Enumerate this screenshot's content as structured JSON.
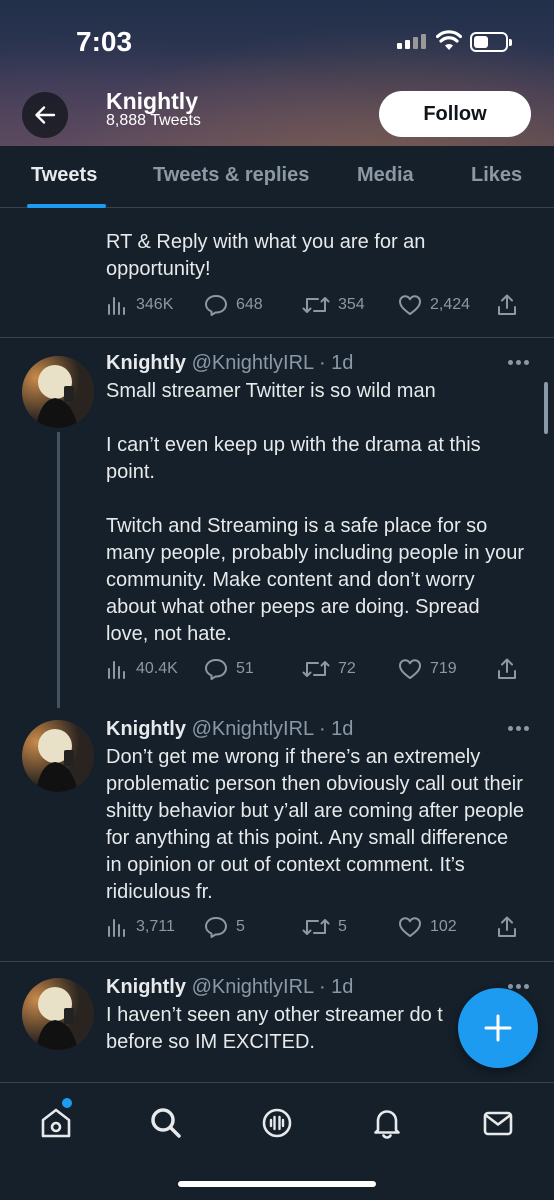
{
  "status_bar": {
    "time": "7:03"
  },
  "header": {
    "name": "Knightly",
    "tweet_count": "8,888 Tweets",
    "follow_label": "Follow"
  },
  "tabs": [
    {
      "label": "Tweets",
      "active": true
    },
    {
      "label": "Tweets & replies",
      "active": false
    },
    {
      "label": "Media",
      "active": false
    },
    {
      "label": "Likes",
      "active": false
    }
  ],
  "tweets": [
    {
      "text": "RT & Reply with what you are for an\nopportunity!",
      "views": "346K",
      "replies": "648",
      "retweets": "354",
      "likes": "2,424"
    },
    {
      "name": "Knightly",
      "handle": "@KnightlyIRL",
      "time": "· 1d",
      "text": "Small streamer Twitter is so wild man\n\nI can’t even keep up with the drama at this point.\n\nTwitch and Streaming is a safe place for so many people, probably including people in your community. Make content and don’t worry about what other peeps are doing. Spread love, not hate.",
      "views": "40.4K",
      "replies": "51",
      "retweets": "72",
      "likes": "719"
    },
    {
      "name": "Knightly",
      "handle": "@KnightlyIRL",
      "time": "· 1d",
      "text": "Don’t get me wrong if there’s an extremely problematic person then obviously call out their shitty behavior but y’all are coming after people for anything at this point. Any small difference in opinion or out of context comment. It’s ridiculous fr.",
      "views": "3,711",
      "replies": "5",
      "retweets": "5",
      "likes": "102"
    },
    {
      "name": "Knightly",
      "handle": "@KnightlyIRL",
      "time": "· 1d",
      "text": "I haven’t seen any other streamer do t\nbefore so IM EXCITED."
    }
  ],
  "icons": {
    "back": "arrow-left-icon",
    "more": "more-dots-icon",
    "views": "analytics-icon",
    "reply": "reply-bubble-icon",
    "retweet": "retweet-icon",
    "like": "heart-icon",
    "share": "share-icon",
    "compose": "plus-icon",
    "nav": [
      "home-icon",
      "search-icon",
      "spaces-icon",
      "notifications-icon",
      "messages-icon"
    ]
  },
  "colors": {
    "background": "#15202b",
    "accent": "#1d9bf0",
    "muted": "#8b98a5",
    "divider": "#38444d"
  }
}
